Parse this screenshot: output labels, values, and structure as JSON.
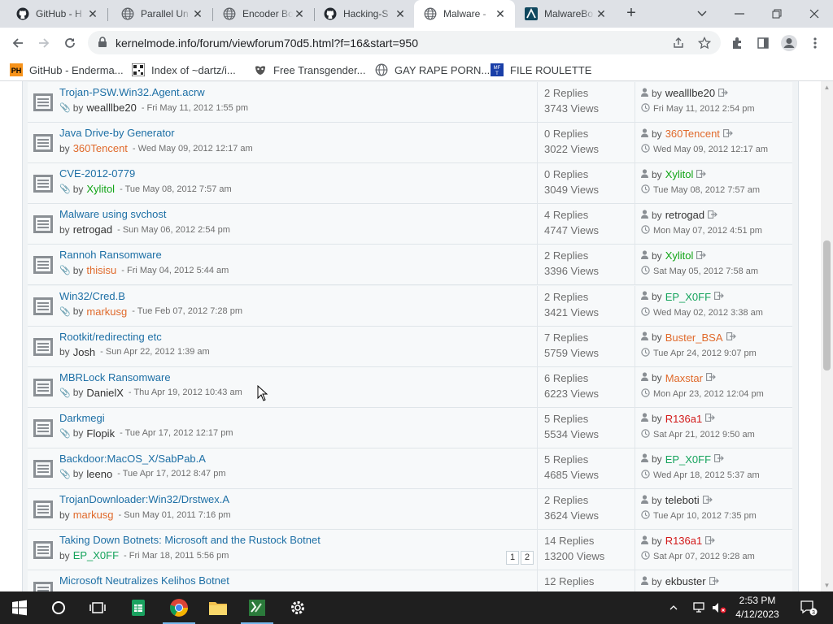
{
  "browser": {
    "tabs": [
      {
        "title": "GitHub - H",
        "icon": "github-icon",
        "active": false
      },
      {
        "title": "Parallel Un",
        "icon": "globe-icon",
        "active": false
      },
      {
        "title": "Encoder Bo",
        "icon": "globe-icon",
        "active": false
      },
      {
        "title": "Hacking-S",
        "icon": "github-icon",
        "active": false
      },
      {
        "title": "Malware -",
        "icon": "globe-icon",
        "active": true
      },
      {
        "title": "MalwareBo",
        "icon": "malwarebazaar-icon",
        "active": false
      }
    ],
    "url": "kernelmode.info/forum/viewforum70d5.html?f=16&start=950",
    "bookmarks": [
      {
        "label": "GitHub - Enderma...",
        "icon": "ph-icon"
      },
      {
        "label": "Index of ~dartz/i...",
        "icon": "qr-icon"
      },
      {
        "label": "Free Transgender...",
        "icon": "mask-icon"
      },
      {
        "label": "GAY RAPE PORN...",
        "icon": "globe-icon"
      },
      {
        "label": "FILE ROULETTE",
        "icon": "mft-icon"
      }
    ]
  },
  "topics": [
    {
      "title": "Trojan-PSW.Win32.Agent.acrw",
      "attachment": true,
      "by": "by",
      "author": "wealllbe20",
      "author_color": "dark",
      "date": "- Fri May 11, 2012 1:55 pm",
      "replies": "2 Replies",
      "views": "3743 Views",
      "last_by": "by",
      "last_user": "wealllbe20",
      "last_user_color": "dark",
      "last_date": "Fri May 11, 2012 2:54 pm"
    },
    {
      "title": "Java Drive-by Generator",
      "attachment": false,
      "by": "by",
      "author": "360Tencent",
      "author_color": "orange",
      "date": "- Wed May 09, 2012 12:17 am",
      "replies": "0 Replies",
      "views": "3022 Views",
      "last_by": "by",
      "last_user": "360Tencent",
      "last_user_color": "orange",
      "last_date": "Wed May 09, 2012 12:17 am"
    },
    {
      "title": "CVE-2012-0779",
      "attachment": true,
      "by": "by",
      "author": "Xylitol",
      "author_color": "green",
      "date": "- Tue May 08, 2012 7:57 am",
      "replies": "0 Replies",
      "views": "3049 Views",
      "last_by": "by",
      "last_user": "Xylitol",
      "last_user_color": "green",
      "last_date": "Tue May 08, 2012 7:57 am"
    },
    {
      "title": "Malware using svchost",
      "attachment": false,
      "by": "by",
      "author": "retrogad",
      "author_color": "dark",
      "date": "- Sun May 06, 2012 2:54 pm",
      "replies": "4 Replies",
      "views": "4747 Views",
      "last_by": "by",
      "last_user": "retrogad",
      "last_user_color": "dark",
      "last_date": "Mon May 07, 2012 4:51 pm"
    },
    {
      "title": "Rannoh Ransomware",
      "attachment": true,
      "by": "by",
      "author": "thisisu",
      "author_color": "orange",
      "date": "- Fri May 04, 2012 5:44 am",
      "replies": "2 Replies",
      "views": "3396 Views",
      "last_by": "by",
      "last_user": "Xylitol",
      "last_user_color": "green",
      "last_date": "Sat May 05, 2012 7:58 am"
    },
    {
      "title": "Win32/Cred.B",
      "attachment": true,
      "by": "by",
      "author": "markusg",
      "author_color": "orange",
      "date": "- Tue Feb 07, 2012 7:28 pm",
      "replies": "2 Replies",
      "views": "3421 Views",
      "last_by": "by",
      "last_user": "EP_X0FF",
      "last_user_color": "teal",
      "last_date": "Wed May 02, 2012 3:38 am"
    },
    {
      "title": "Rootkit/redirecting etc",
      "attachment": false,
      "by": "by",
      "author": "Josh",
      "author_color": "dark",
      "date": "- Sun Apr 22, 2012 1:39 am",
      "replies": "7 Replies",
      "views": "5759 Views",
      "last_by": "by",
      "last_user": "Buster_BSA",
      "last_user_color": "orange",
      "last_date": "Tue Apr 24, 2012 9:07 pm"
    },
    {
      "title": "MBRLock Ransomware",
      "attachment": true,
      "by": "by",
      "author": "DanielX",
      "author_color": "dark",
      "date": "- Thu Apr 19, 2012 10:43 am",
      "replies": "6 Replies",
      "views": "6223 Views",
      "last_by": "by",
      "last_user": "Maxstar",
      "last_user_color": "orange",
      "last_date": "Mon Apr 23, 2012 12:04 pm"
    },
    {
      "title": "Darkmegi",
      "attachment": true,
      "by": "by",
      "author": "Flopik",
      "author_color": "dark",
      "date": "- Tue Apr 17, 2012 12:17 pm",
      "replies": "5 Replies",
      "views": "5534 Views",
      "last_by": "by",
      "last_user": "R136a1",
      "last_user_color": "red",
      "last_date": "Sat Apr 21, 2012 9:50 am"
    },
    {
      "title": "Backdoor:MacOS_X/SabPab.A",
      "attachment": true,
      "by": "by",
      "author": "leeno",
      "author_color": "dark",
      "date": "- Tue Apr 17, 2012 8:47 pm",
      "replies": "5 Replies",
      "views": "4685 Views",
      "last_by": "by",
      "last_user": "EP_X0FF",
      "last_user_color": "teal",
      "last_date": "Wed Apr 18, 2012 5:37 am"
    },
    {
      "title": "TrojanDownloader:Win32/Drstwex.A",
      "attachment": false,
      "by": "by",
      "author": "markusg",
      "author_color": "orange",
      "date": "- Sun May 01, 2011 7:16 pm",
      "replies": "2 Replies",
      "views": "3624 Views",
      "last_by": "by",
      "last_user": "teleboti",
      "last_user_color": "dark",
      "last_date": "Tue Apr 10, 2012 7:35 pm"
    },
    {
      "title": "Taking Down Botnets: Microsoft and the Rustock Botnet",
      "attachment": false,
      "by": "by",
      "author": "EP_X0FF",
      "author_color": "teal",
      "date": "- Fri Mar 18, 2011 5:56 pm",
      "pages": [
        "1",
        "2"
      ],
      "replies": "14 Replies",
      "views": "13200 Views",
      "last_by": "by",
      "last_user": "R136a1",
      "last_user_color": "red",
      "last_date": "Sat Apr 07, 2012 9:28 am"
    },
    {
      "title": "Microsoft Neutralizes Kelihos Botnet",
      "attachment": false,
      "by": "by",
      "author": "",
      "author_color": "dark",
      "date": "",
      "replies": "12 Replies",
      "views": "",
      "last_by": "by",
      "last_user": "ekbuster",
      "last_user_color": "dark",
      "last_date": ""
    }
  ],
  "taskbar": {
    "clock_time": "2:53 PM",
    "clock_date": "4/12/2023",
    "notification_count": "3",
    "apps": [
      "start-icon",
      "cortana-icon",
      "task-view-icon",
      "sheets-icon",
      "chrome-icon",
      "file-explorer-icon",
      "excel-icon",
      "settings-icon"
    ]
  },
  "colors": {
    "link": "#1d6fa5",
    "user_orange": "#e06a2c",
    "user_green": "#11a416",
    "user_teal": "#15a35c",
    "user_red": "#d21a1a"
  }
}
